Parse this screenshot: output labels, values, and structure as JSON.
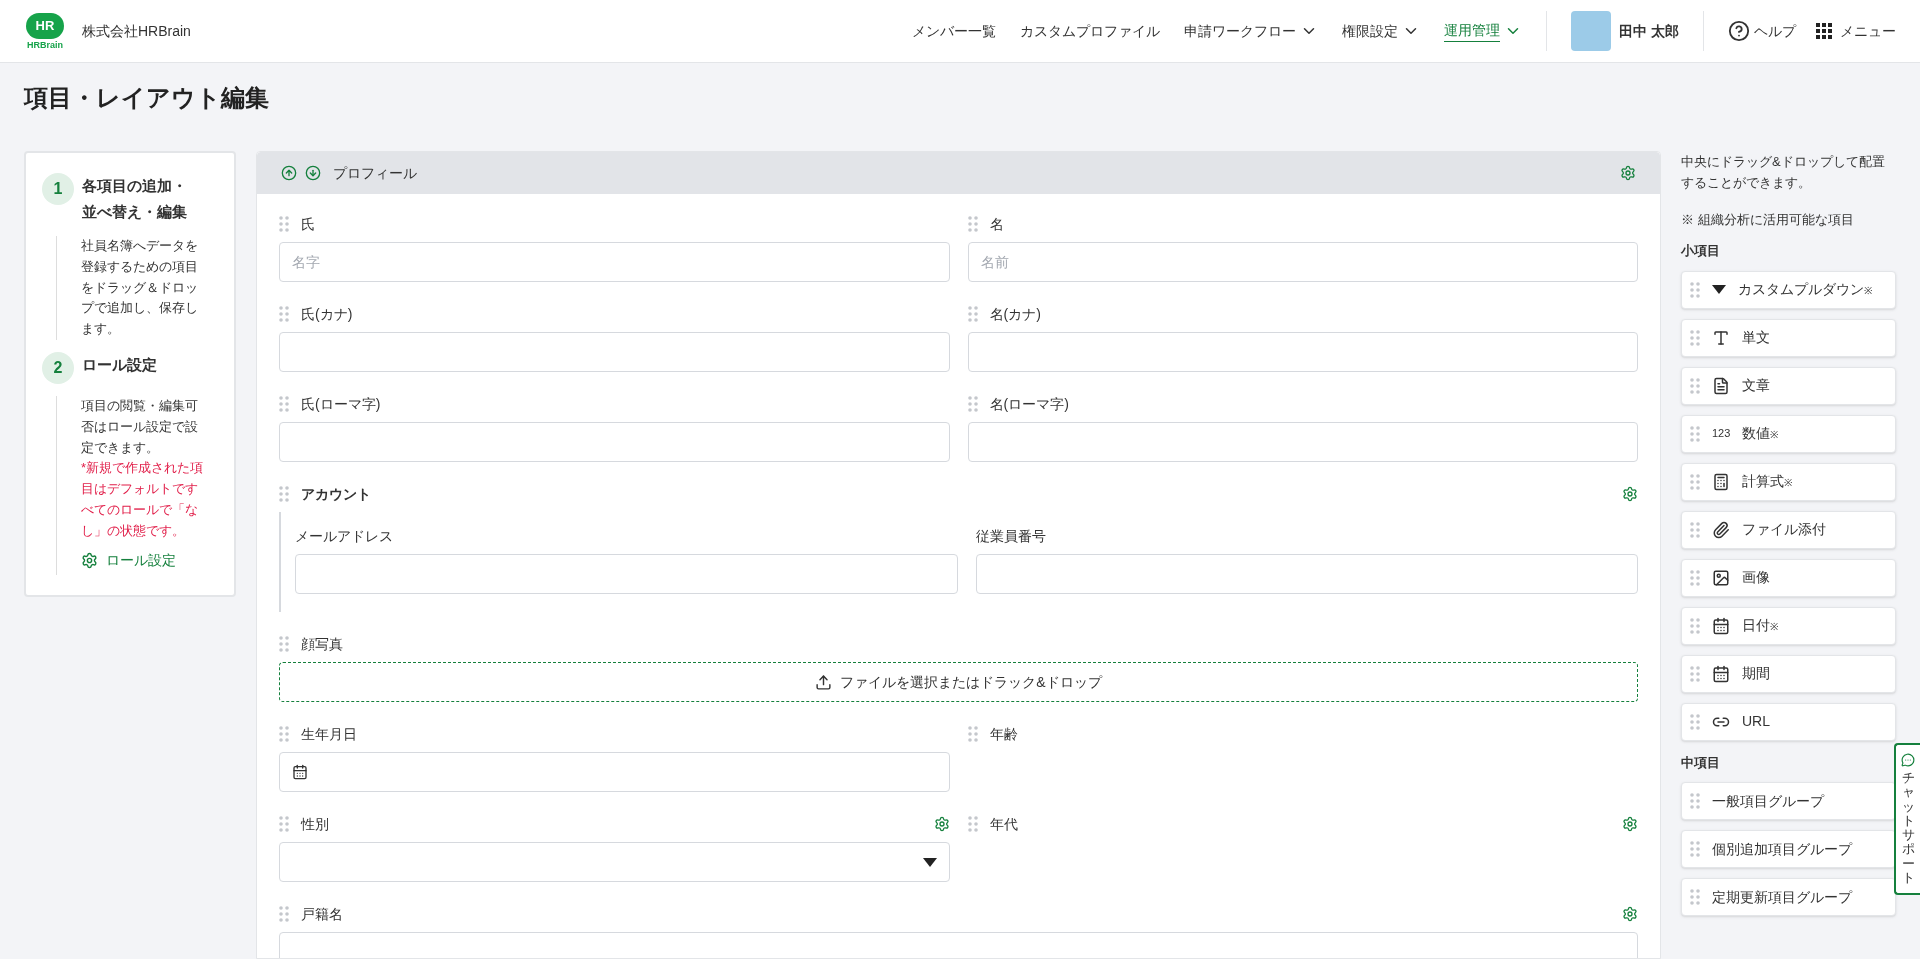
{
  "header": {
    "logo": {
      "mark": "HR",
      "name": "HRBrain"
    },
    "company": "株式会社HRBrain",
    "nav": [
      {
        "label": "メンバー一覧",
        "dropdown": false,
        "selected": false
      },
      {
        "label": "カスタムプロファイル",
        "dropdown": false,
        "selected": false
      },
      {
        "label": "申請ワークフロー",
        "dropdown": true,
        "selected": false
      },
      {
        "label": "権限設定",
        "dropdown": true,
        "selected": false
      },
      {
        "label": "運用管理",
        "dropdown": true,
        "selected": true
      }
    ],
    "user": "田中 太郎",
    "help": "ヘルプ",
    "menu": "メニュー"
  },
  "page_title": "項目・レイアウト編集",
  "steps": [
    {
      "number": "1",
      "title": "各項目の追加・並べ替え・編集",
      "body": "社員名簿へデータを登録するための項目をドラッグ＆ドロップで追加し、保存します。"
    },
    {
      "number": "2",
      "title": "ロール設定",
      "body": "項目の閲覧・編集可否はロール設定で設定できます。",
      "note": "*新規で作成された項目はデフォルトですべてのロールで「なし」の状態です。",
      "link": "ロール設定"
    }
  ],
  "form": {
    "title": "プロフィール",
    "rows": [
      {
        "kind": "pair",
        "fields": [
          {
            "label": "氏",
            "kind": "text",
            "placeholder": "名字",
            "configurable": false
          },
          {
            "label": "名",
            "kind": "text",
            "placeholder": "名前",
            "configurable": false
          }
        ]
      },
      {
        "kind": "pair",
        "fields": [
          {
            "label": "氏(カナ)",
            "kind": "text",
            "configurable": false
          },
          {
            "label": "名(カナ)",
            "kind": "text",
            "configurable": false
          }
        ]
      },
      {
        "kind": "pair",
        "fields": [
          {
            "label": "氏(ローマ字)",
            "kind": "text",
            "configurable": false
          },
          {
            "label": "名(ローマ字)",
            "kind": "text",
            "configurable": false
          }
        ]
      },
      {
        "kind": "group",
        "label": "アカウント",
        "configurable": true,
        "fields": [
          {
            "label": "メールアドレス",
            "kind": "text",
            "configurable": false
          },
          {
            "label": "従業員番号",
            "kind": "text",
            "configurable": false
          }
        ]
      },
      {
        "kind": "single",
        "fields": [
          {
            "label": "顔写真",
            "kind": "upload",
            "text": "ファイルを選択またはドラック&ドロップ",
            "configurable": false
          }
        ]
      },
      {
        "kind": "pair",
        "fields": [
          {
            "label": "生年月日",
            "kind": "date",
            "configurable": false
          },
          {
            "label": "年齢",
            "kind": "none",
            "configurable": false
          }
        ]
      },
      {
        "kind": "pair",
        "fields": [
          {
            "label": "性別",
            "kind": "select",
            "configurable": true
          },
          {
            "label": "年代",
            "kind": "none",
            "configurable": true
          }
        ]
      },
      {
        "kind": "single",
        "fields": [
          {
            "label": "戸籍名",
            "kind": "text",
            "configurable": true
          }
        ]
      }
    ]
  },
  "palette": {
    "intro": "中央にドラッグ&ドロップして配置することができます。",
    "legend": "※ 組織分析に活用可能な項目",
    "sections": [
      {
        "title": "小項目",
        "items": [
          {
            "label": "カスタムプルダウン",
            "kind": "dropdown",
            "analytic": true
          },
          {
            "label": "単文",
            "kind": "line",
            "analytic": false
          },
          {
            "label": "文章",
            "kind": "paragraph",
            "analytic": false
          },
          {
            "label": "数値",
            "kind": "number",
            "analytic": true,
            "icon_text": "123"
          },
          {
            "label": "計算式",
            "kind": "formula",
            "analytic": true
          },
          {
            "label": "ファイル添付",
            "kind": "file",
            "analytic": false
          },
          {
            "label": "画像",
            "kind": "image",
            "analytic": false
          },
          {
            "label": "日付",
            "kind": "date",
            "analytic": true
          },
          {
            "label": "期間",
            "kind": "period",
            "analytic": false
          },
          {
            "label": "URL",
            "kind": "url",
            "analytic": false
          }
        ]
      },
      {
        "title": "中項目",
        "items": [
          {
            "label": "一般項目グループ",
            "kind": "group",
            "analytic": false
          },
          {
            "label": "個別追加項目グループ",
            "kind": "group",
            "analytic": false
          },
          {
            "label": "定期更新項目グループ",
            "kind": "group",
            "analytic": false
          }
        ]
      }
    ],
    "analytic_mark": "※"
  },
  "chat": "チャットサポート"
}
